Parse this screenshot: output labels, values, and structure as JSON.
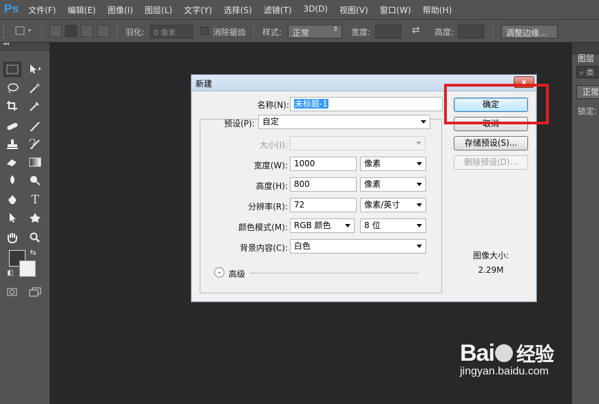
{
  "app": {
    "logo": "Ps"
  },
  "menu": [
    "文件(F)",
    "编辑(E)",
    "图像(I)",
    "图层(L)",
    "文字(Y)",
    "选择(S)",
    "滤镜(T)",
    "3D(D)",
    "视图(V)",
    "窗口(W)",
    "帮助(H)"
  ],
  "options": {
    "feather_label": "羽化:",
    "feather_value": "0 像素",
    "antialias_label": "消除锯齿",
    "style_label": "样式:",
    "style_value": "正常",
    "width_label": "宽度:",
    "height_label": "高度:",
    "refine_edge": "调整边缘..."
  },
  "right_panel": {
    "tab": "图层",
    "search": "类",
    "blend_mode": "正常",
    "lock_label": "锁定:"
  },
  "dialog": {
    "title": "新建",
    "close": "x",
    "name_label": "名称(N):",
    "name_value": "未标题-1",
    "preset_label": "预设(P):",
    "preset_value": "自定",
    "size_label": "大小(I):",
    "width_label": "宽度(W):",
    "width_value": "1000",
    "width_unit": "像素",
    "height_label": "高度(H):",
    "height_value": "800",
    "height_unit": "像素",
    "resolution_label": "分辨率(R):",
    "resolution_value": "72",
    "resolution_unit": "像素/英寸",
    "color_mode_label": "颜色模式(M):",
    "color_mode_value": "RGB 颜色",
    "bit_depth": "8 位",
    "background_label": "背景内容(C):",
    "background_value": "白色",
    "advanced_label": "高级",
    "ok_button": "确定",
    "cancel_button": "取消",
    "save_preset_button": "存储预设(S)...",
    "delete_preset_button": "删除预设(D)...",
    "image_size_label": "图像大小:",
    "image_size_value": "2.29M"
  },
  "watermark": {
    "logo_text_1": "Bai",
    "logo_text_2": "经验",
    "url": "jingyan.baidu.com"
  },
  "colors": {
    "highlight": "#e02020",
    "menubar": "#535353",
    "canvas": "#282828"
  }
}
